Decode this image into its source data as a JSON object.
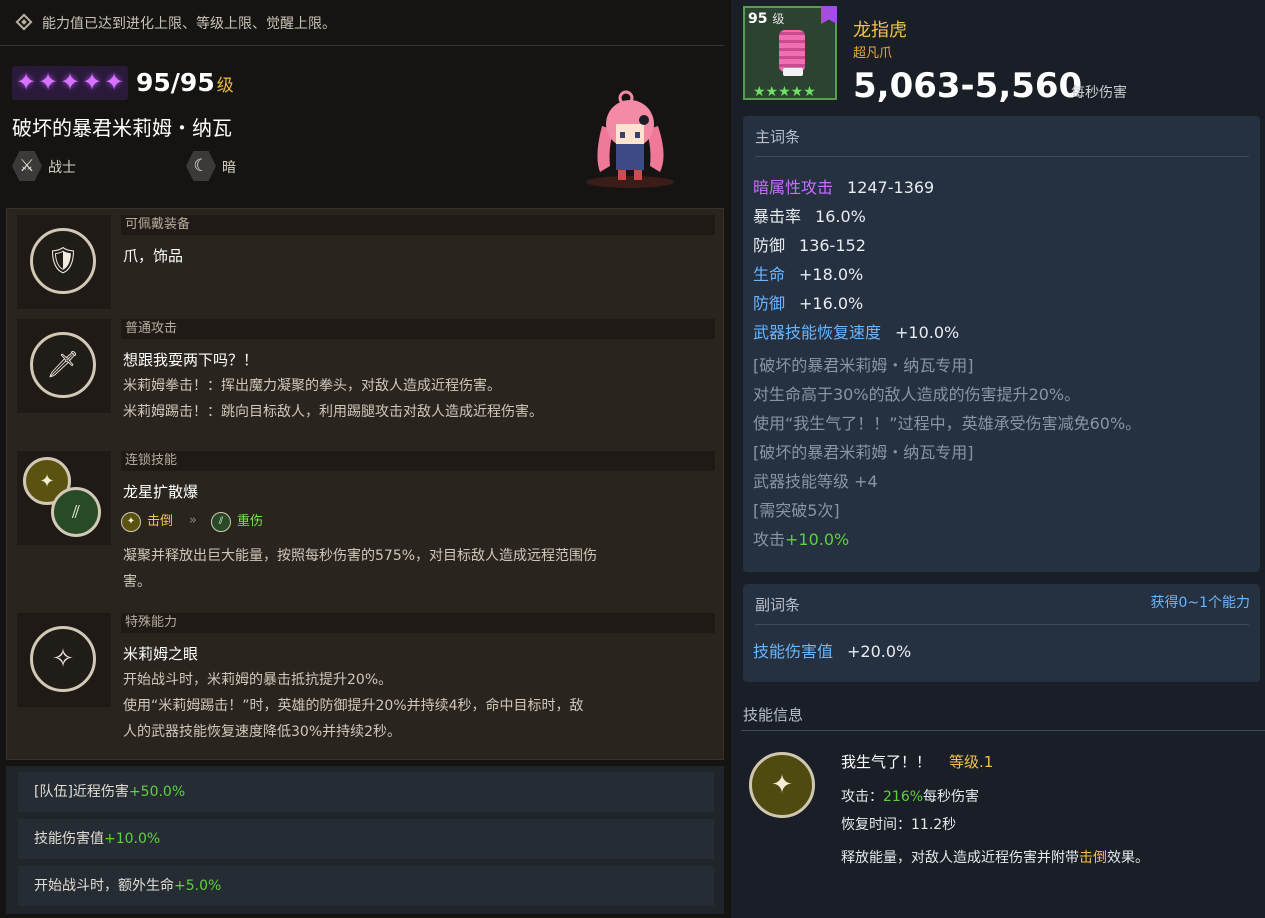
{
  "notice": "能力值已达到进化上限、等级上限、觉醒上限。",
  "hero": {
    "stars": 5,
    "level_text": "95/95",
    "level_unit": "级",
    "name": "破坏的暴君米莉姆・纳瓦",
    "class_label": "战士",
    "element_label": "暗"
  },
  "skills": [
    {
      "header": "可佩戴装备",
      "title": "爪，饰品",
      "lines": []
    },
    {
      "header": "普通攻击",
      "title": "想跟我耍两下吗？！",
      "lines": [
        "米莉姆拳击！：挥出魔力凝聚的拳头，对敌人造成近程伤害。",
        "米莉姆踢击！：跳向目标敌人，利用踢腿攻击对敌人造成近程伤害。"
      ]
    },
    {
      "header": "连锁技能",
      "title": "龙星扩散爆",
      "chain_from": "击倒",
      "chain_to": "重伤",
      "lines": [
        "凝聚并释放出巨大能量，按照每秒伤害的575%，对目标敌人造成远程范围伤",
        "害。"
      ]
    },
    {
      "header": "特殊能力",
      "title": "米莉姆之眼",
      "lines": [
        "开始战斗时，米莉姆的暴击抵抗提升20%。",
        "使用“米莉姆踢击！”时，英雄的防御提升20%并持续4秒，命中目标时，敌",
        "人的武器技能恢复速度降低30%并持续2秒。"
      ]
    }
  ],
  "bonuses": [
    {
      "label": "[队伍]近程伤害",
      "value": "+50.0%"
    },
    {
      "label": "技能伤害值",
      "value": "+10.0%"
    },
    {
      "label": "开始战斗时，额外生命",
      "value": "+5.0%"
    }
  ],
  "item": {
    "level": "95",
    "level_unit": "级",
    "name": "龙指虎",
    "type": "超凡爪",
    "stars": "★★★★★",
    "dps": "5,063-5,560",
    "dps_label": "每秒伤害"
  },
  "main_stats": {
    "title": "主词条",
    "rows": [
      {
        "k": "暗属性攻击",
        "v": "1247-1369",
        "kcolor": "purple"
      },
      {
        "k": "暴击率",
        "v": "16.0%",
        "kcolor": ""
      },
      {
        "k": "防御",
        "v": "136-152",
        "kcolor": ""
      },
      {
        "k": "生命",
        "v": "+18.0%",
        "kcolor": "blue"
      },
      {
        "k": "防御",
        "v": "+16.0%",
        "kcolor": "blue"
      },
      {
        "k": "武器技能恢复速度",
        "v": "+10.0%",
        "kcolor": "blue"
      }
    ],
    "grey_lines": [
      "[破坏的暴君米莉姆・纳瓦专用]",
      "对生命高于30%的敌人造成的伤害提升20%。",
      "使用“我生气了！！”过程中，英雄承受伤害减免60%。",
      "[破坏的暴君米莉姆・纳瓦专用]",
      "武器技能等级 +4",
      "[需突破5次]"
    ],
    "last_label": "攻击",
    "last_value": "+10.0%"
  },
  "sub_stats": {
    "title": "副词条",
    "right_label": "获得0~1个能力",
    "row_k": "技能伤害值",
    "row_v": "+20.0%"
  },
  "skill_info": {
    "title": "技能信息",
    "name": "我生气了！！",
    "level": "等级.1",
    "attack_label": "攻击：",
    "attack_value": "216%",
    "attack_suffix": "每秒伤害",
    "cooldown": "恢复时间：11.2秒",
    "desc_pre": "释放能量，对敌人造成近程伤害并附带",
    "desc_key": "击倒",
    "desc_post": "效果。"
  }
}
